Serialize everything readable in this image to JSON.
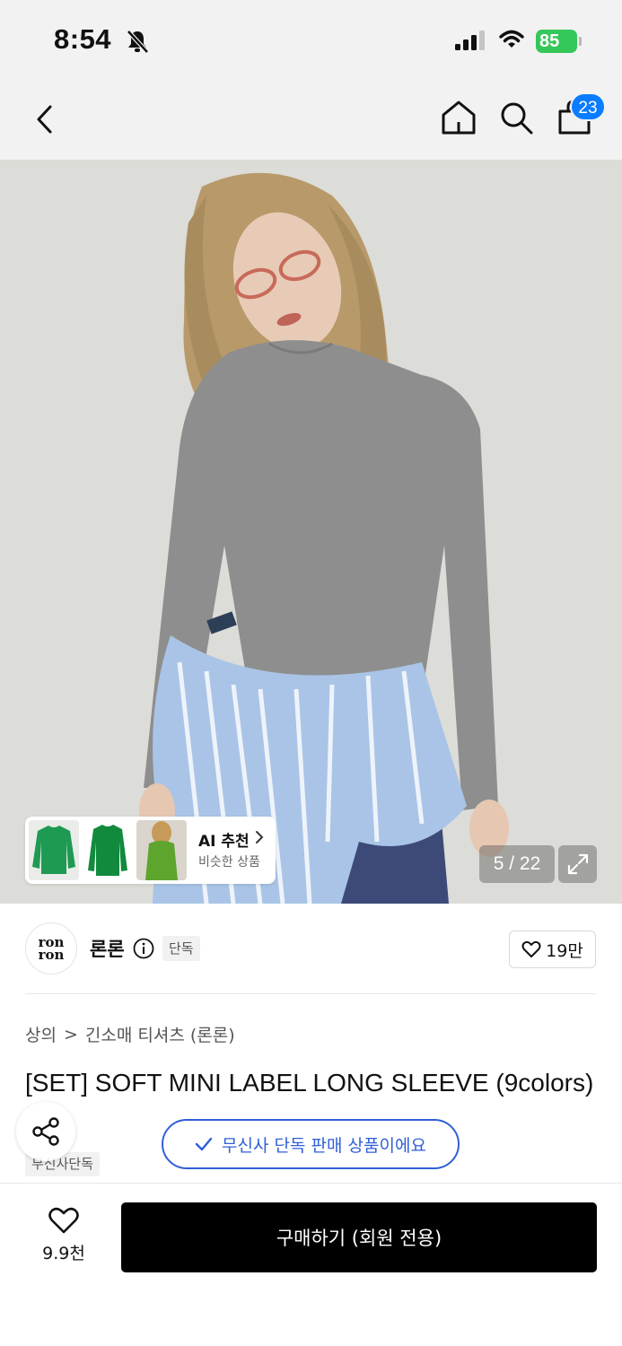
{
  "status_bar": {
    "time": "8:54",
    "battery": "85"
  },
  "header": {
    "cart_count": "23"
  },
  "ai_recommend": {
    "title": "AI 추천",
    "subtitle": "비슷한 상품"
  },
  "image_counter": "5 / 22",
  "brand": {
    "logo_line1": "ron",
    "logo_line2": "ron",
    "name": "론론",
    "exclusive_tag": "단독",
    "likes": "19만"
  },
  "breadcrumb": {
    "category": "상의",
    "separator": ">",
    "subcategory": "긴소매 티셔츠 (론론)"
  },
  "product": {
    "title": "[SET] SOFT MINI LABEL LONG SLEEVE (9colors)",
    "store_tag": "무신사단독"
  },
  "exclusive_notice": "무신사 단독 판매 상품이에요",
  "bottom_bar": {
    "wish_count": "9.9천",
    "buy_label": "구매하기 (회원 전용)"
  },
  "colors": {
    "accent_blue": "#2f5fd8",
    "badge_blue": "#0a7cff",
    "buy_button": "#000000",
    "battery_green": "#34c759"
  }
}
